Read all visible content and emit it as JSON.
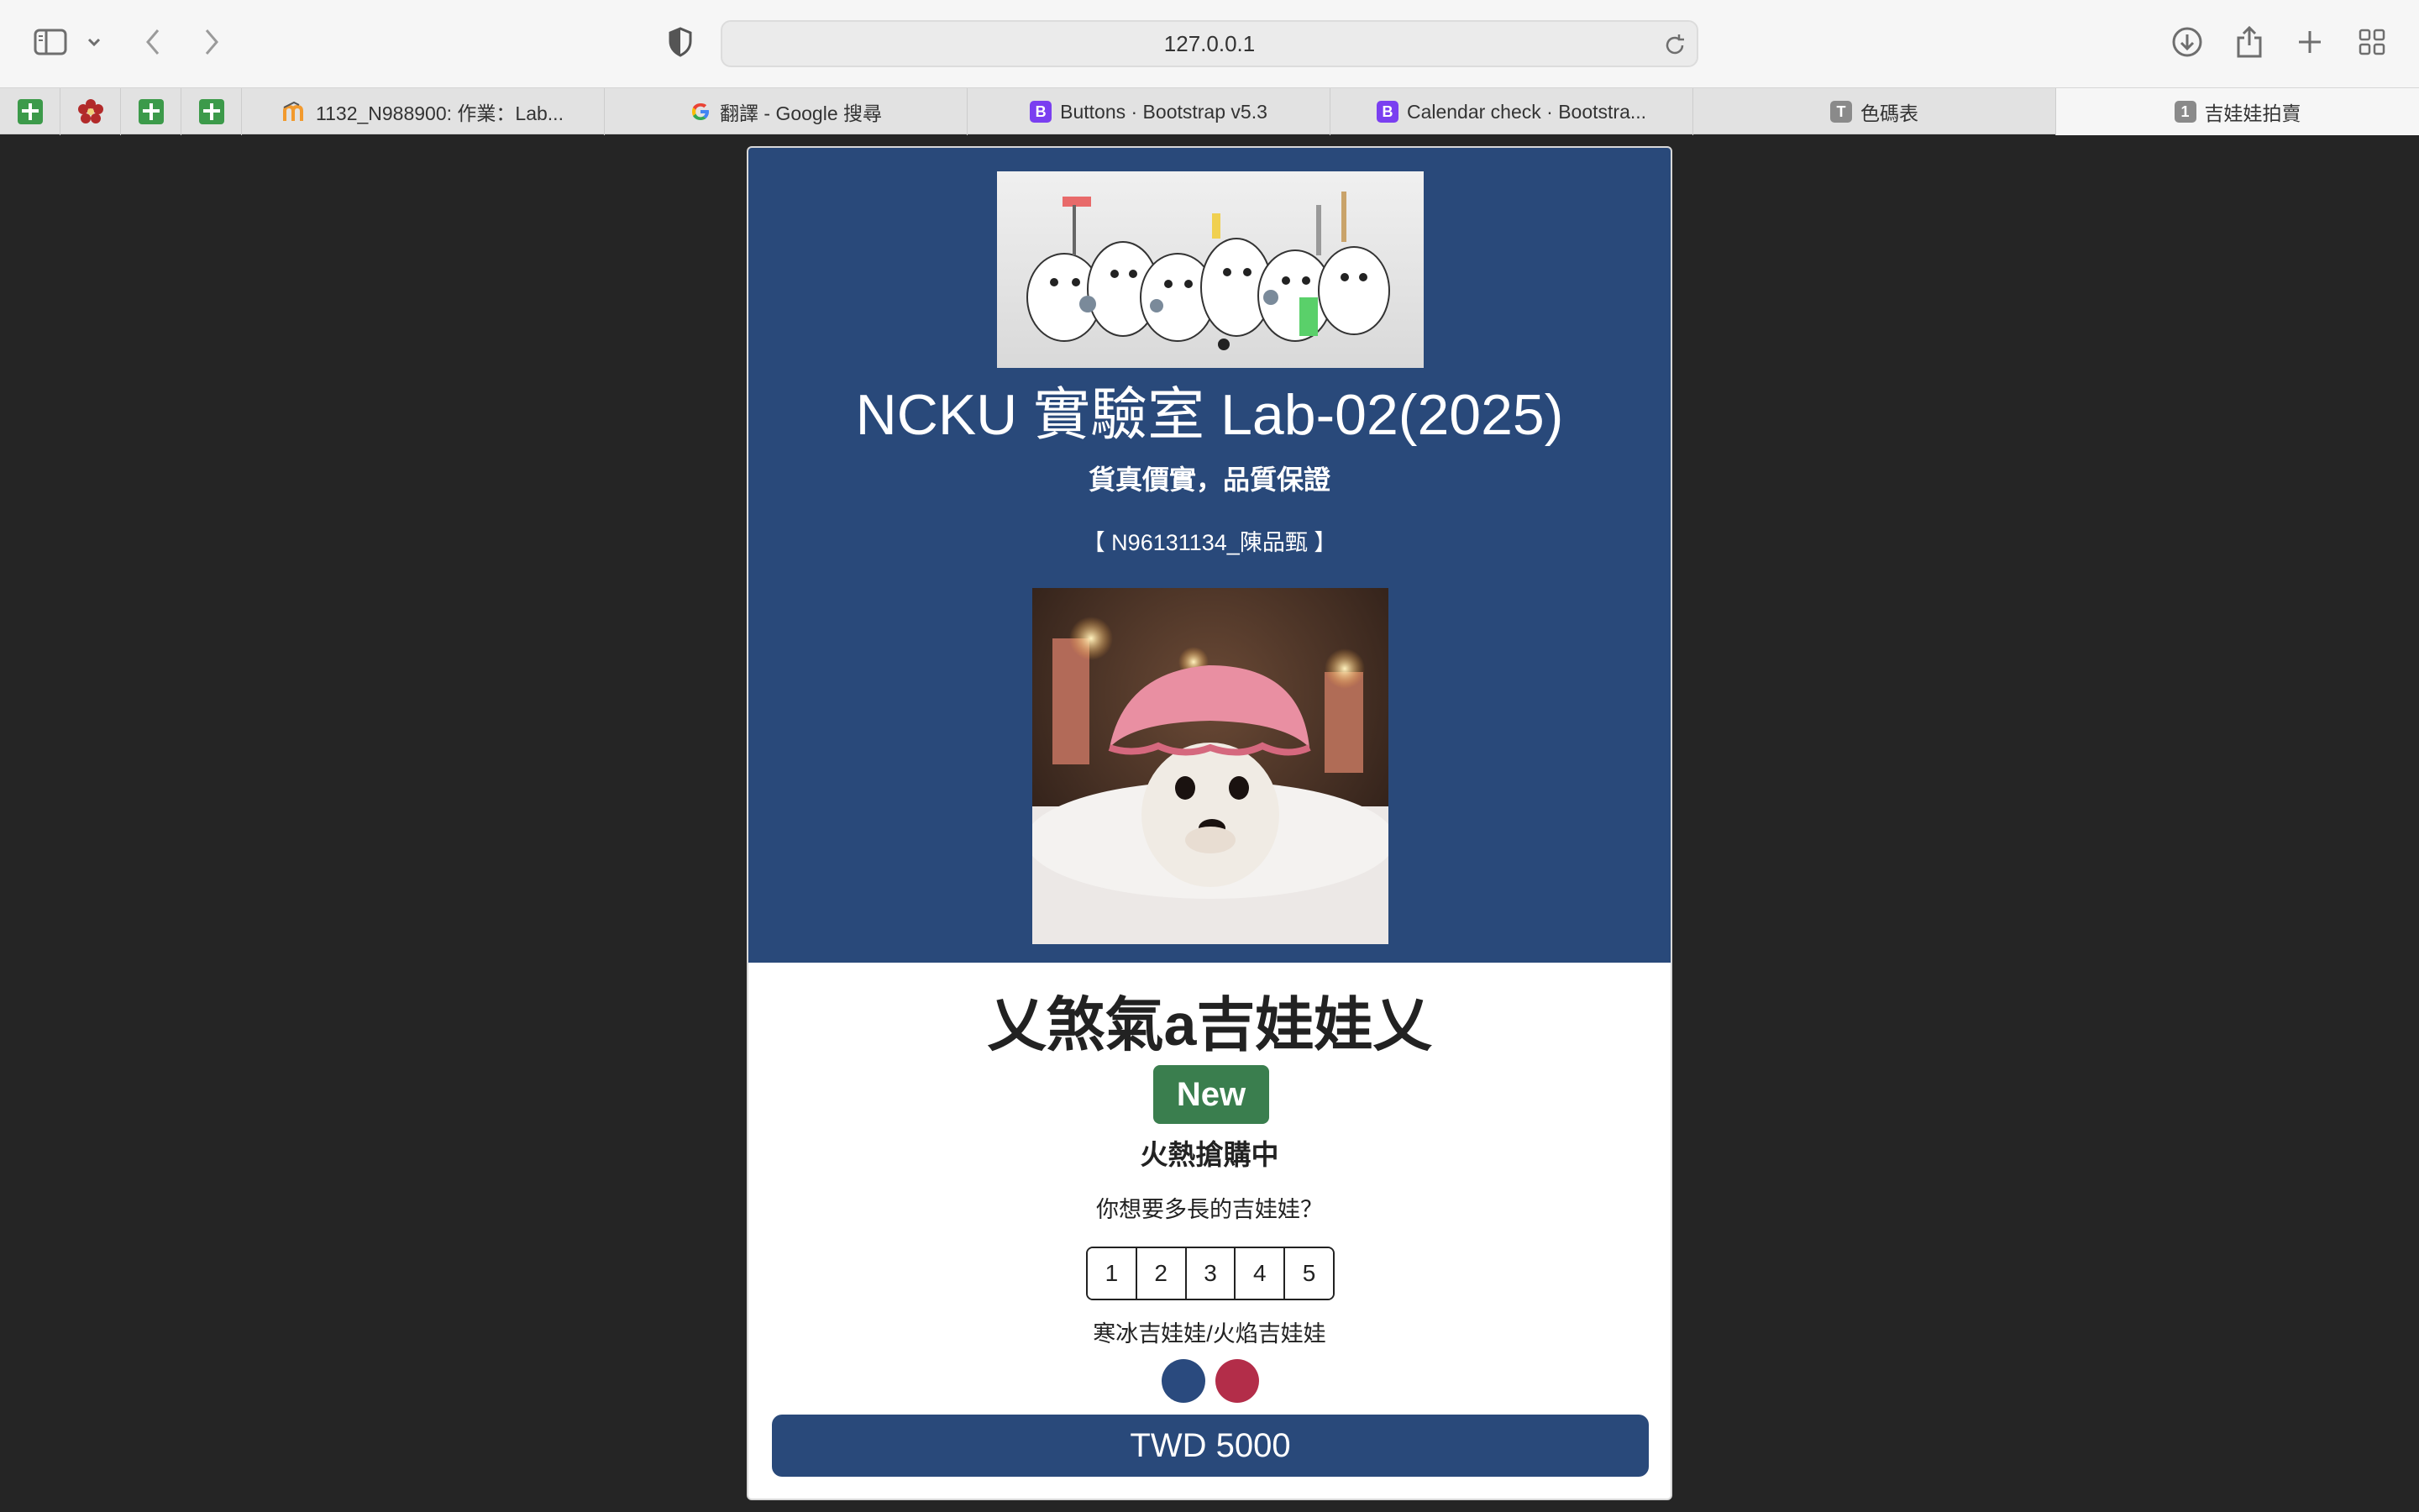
{
  "browser": {
    "url": "127.0.0.1",
    "tabs": [
      {
        "label": "1132_N988900: 作業：Lab...",
        "favicon": "moodle-icon"
      },
      {
        "label": "翻譯 - Google 搜尋",
        "favicon": "google-icon"
      },
      {
        "label": "Buttons · Bootstrap v5.3",
        "favicon": "B"
      },
      {
        "label": "Calendar check · Bootstra...",
        "favicon": "B"
      },
      {
        "label": "色碼表",
        "favicon": "T"
      },
      {
        "label": "吉娃娃拍賣",
        "favicon": "1"
      }
    ]
  },
  "hero": {
    "title": "NCKU 實驗室 Lab-02(2025)",
    "slogan": "貨真價實，品質保證",
    "student": "【 N96131134_陳品甄 】"
  },
  "product": {
    "name": "乂煞氣a吉娃娃乂",
    "badge": "New",
    "status": "火熱搶購中",
    "size_question": "你想要多長的吉娃娃？",
    "sizes": [
      "1",
      "2",
      "3",
      "4",
      "5"
    ],
    "color_label": "寒冰吉娃娃/火焰吉娃娃",
    "price": "TWD 5000"
  },
  "colors": {
    "hero_bg": "#29497a",
    "badge": "#3a7e4e",
    "ice": "#2a4a7e",
    "fire": "#b32d49"
  }
}
